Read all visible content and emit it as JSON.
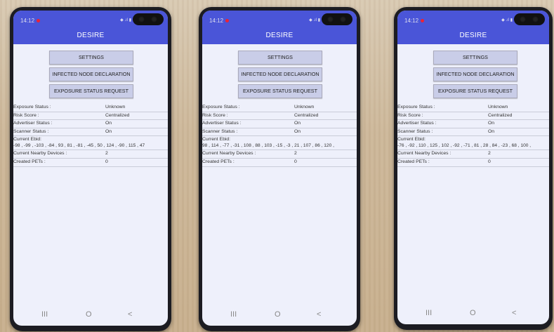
{
  "phones": [
    {
      "time": "14:12",
      "title": "DESIRE",
      "buttons": [
        "SETTINGS",
        "INFECTED NODE DECLARATION",
        "EXPOSURE STATUS REQUEST"
      ],
      "rows": [
        {
          "k": "Exposure Status :",
          "v": "Unknown"
        },
        {
          "k": "Risk Score :",
          "v": "Centralized"
        },
        {
          "k": "Advertiser Status :",
          "v": "On"
        },
        {
          "k": "Scanner Status :",
          "v": "On"
        }
      ],
      "ebid_label": "Current Ebid:",
      "ebid_values": "-98 , -99 , -103 , -84 , 93 , 81 , -81 , -45 , 50 , 124 , -90 , 115 , 47",
      "rows2": [
        {
          "k": "Current Nearby Devices :",
          "v": "2"
        },
        {
          "k": "Created PETs :",
          "v": "0"
        }
      ],
      "nav": [
        "III",
        "O",
        "<"
      ]
    },
    {
      "time": "14:12",
      "title": "DESIRE",
      "buttons": [
        "SETTINGS",
        "INFECTED NODE DECLARATION",
        "EXPOSURE STATUS REQUEST"
      ],
      "rows": [
        {
          "k": "Exposure Status :",
          "v": "Unknown"
        },
        {
          "k": "Risk Score :",
          "v": "Centralized"
        },
        {
          "k": "Advertiser Status :",
          "v": "On"
        },
        {
          "k": "Scanner Status :",
          "v": "On"
        }
      ],
      "ebid_label": "Current Ebid:",
      "ebid_values": "98 , 114 , -77 , -31 , 108 , 88 , 103 , -15 , -3 , 21 , 107 , 86 , 120 ,",
      "rows2": [
        {
          "k": "Current Nearby Devices :",
          "v": "2"
        },
        {
          "k": "Created PETs :",
          "v": "0"
        }
      ],
      "nav": [
        "III",
        "O",
        "<"
      ]
    },
    {
      "time": "14:12",
      "title": "DESIRE",
      "buttons": [
        "SETTINGS",
        "INFECTED NODE DECLARATION",
        "EXPOSURE STATUS REQUEST"
      ],
      "rows": [
        {
          "k": "Exposure Status :",
          "v": "Unknown"
        },
        {
          "k": "Risk Score :",
          "v": "Centralized"
        },
        {
          "k": "Advertiser Status :",
          "v": "On"
        },
        {
          "k": "Scanner Status :",
          "v": "On"
        }
      ],
      "ebid_label": "Current Ebid:",
      "ebid_values": "-76 , -92 , 110 , 125 , 102 , -92 , -71 , 81 , 28 , 84 , -23 , 68 , 100 ,",
      "rows2": [
        {
          "k": "Current Nearby Devices :",
          "v": "2"
        },
        {
          "k": "Created PETs :",
          "v": "0"
        }
      ],
      "nav": [
        "III",
        "O",
        "<"
      ]
    }
  ]
}
